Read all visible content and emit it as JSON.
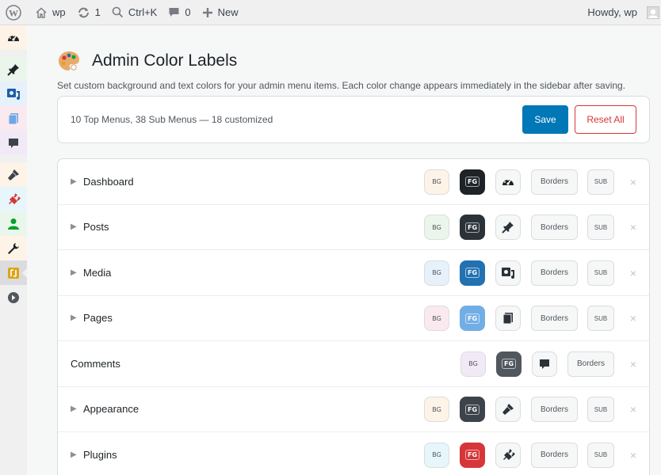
{
  "adminbar": {
    "site_name": "wp",
    "updates_count": "1",
    "search_shortcut": "Ctrl+K",
    "comments_count": "0",
    "new_label": "New",
    "greeting": "Howdy, wp"
  },
  "sidebar": {
    "items": [
      {
        "name": "dashboard",
        "bg": "#fdf3e7",
        "color": "#1d2327"
      },
      {
        "name": "posts",
        "bg": "#eaf6ec",
        "color": "#1d2327"
      },
      {
        "name": "media",
        "bg": "#e6f1fb",
        "color": "#1f5ea8"
      },
      {
        "name": "pages",
        "bg": "#fbe9f0",
        "color": "#6fa8e6"
      },
      {
        "name": "comments",
        "bg": "#f2e9f6",
        "color": "#3c434a"
      },
      {
        "name": "appearance",
        "bg": "#fdf3e7",
        "color": "#3c434a"
      },
      {
        "name": "plugins",
        "bg": "#e6f6fa",
        "color": "#d63638"
      },
      {
        "name": "users",
        "bg": "#eaf6ec",
        "color": "#00a32a"
      },
      {
        "name": "tools",
        "bg": "#fdf3e7",
        "color": "#1d2327"
      },
      {
        "name": "admin-color-labels",
        "bg": "#dcdcde",
        "color": "#dba617"
      },
      {
        "name": "collapse",
        "bg": "#f0f0f1",
        "color": "#50575e"
      }
    ]
  },
  "page": {
    "title": "Admin Color Labels",
    "description": "Set custom background and text colors for your admin menu items. Each color change appears immediately in the sidebar after saving."
  },
  "summary": {
    "text": "10 Top Menus, 38 Sub Menus — 18 customized",
    "save_label": "Save",
    "reset_label": "Reset All"
  },
  "menus": [
    {
      "label": "Dashboard",
      "toggle": "▶",
      "bg_label": "BG",
      "fg_label": "FG",
      "bg": "#fdf3e7",
      "fg": "#1d2327",
      "icon": "dashboard-icon",
      "borders_label": "Borders",
      "sub_label": "SUB",
      "close": "×"
    },
    {
      "label": "Posts",
      "toggle": "▶",
      "bg_label": "BG",
      "fg_label": "FG",
      "bg": "#eaf6ec",
      "fg": "#2c3338",
      "icon": "pin-icon",
      "borders_label": "Borders",
      "sub_label": "SUB",
      "close": "×"
    },
    {
      "label": "Media",
      "toggle": "▶",
      "bg_label": "BG",
      "fg_label": "FG",
      "bg": "#e6f1fb",
      "fg": "#2271b1",
      "icon": "media-icon",
      "borders_label": "Borders",
      "sub_label": "SUB",
      "close": "×"
    },
    {
      "label": "Pages",
      "toggle": "▶",
      "bg_label": "BG",
      "fg_label": "FG",
      "bg": "#fbe9f0",
      "fg": "#72aee6",
      "icon": "pages-icon",
      "borders_label": "Borders",
      "sub_label": "SUB",
      "close": "×"
    },
    {
      "label": "Comments",
      "toggle": "",
      "bg_label": "BG",
      "fg_label": "FG",
      "bg": "#f2e9f6",
      "fg": "#50575e",
      "icon": "comment-icon",
      "borders_label": "Borders",
      "sub_label": "",
      "close": "×"
    },
    {
      "label": "Appearance",
      "toggle": "▶",
      "bg_label": "BG",
      "fg_label": "FG",
      "bg": "#fdf3e7",
      "fg": "#3c434a",
      "icon": "brush-icon",
      "borders_label": "Borders",
      "sub_label": "SUB",
      "close": "×"
    },
    {
      "label": "Plugins",
      "toggle": "▶",
      "bg_label": "BG",
      "fg_label": "FG",
      "bg": "#e6f6fa",
      "fg": "#d63638",
      "icon": "plugin-icon",
      "borders_label": "Borders",
      "sub_label": "SUB",
      "close": "×"
    }
  ]
}
